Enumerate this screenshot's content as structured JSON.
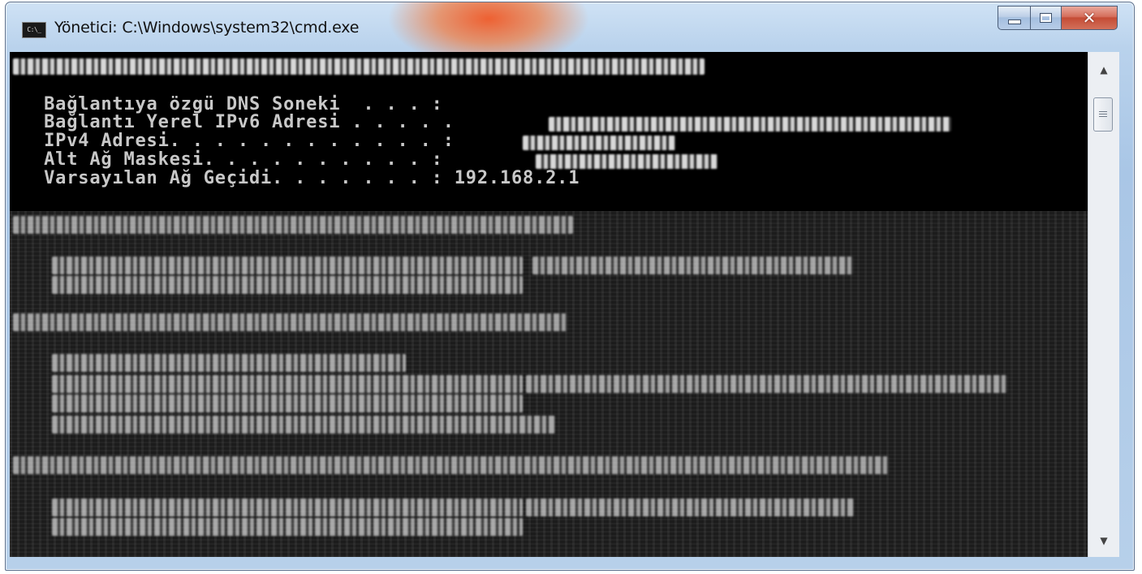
{
  "window": {
    "title": "Yönetici: C:\\Windows\\system32\\cmd.exe",
    "icon": "cmd-icon",
    "icon_text": "C:\\_",
    "buttons": {
      "minimize": "minimize-icon",
      "maximize": "maximize-icon",
      "close": "close-icon"
    }
  },
  "console": {
    "lines": [
      "   Bağlantıya özgü DNS Soneki  . . . :",
      "   Bağlantı Yerel IPv6 Adresi . . . . .",
      "   IPv4 Adresi. . . . . . . . . . . . :",
      "   Alt Ağ Maskesi. . . . . . . . . . :",
      "   Varsayılan Ağ Geçidi. . . . . . . : 192.168.2.1"
    ]
  },
  "scrollbar": {
    "up": "scroll-up-icon",
    "down": "scroll-down-icon"
  }
}
